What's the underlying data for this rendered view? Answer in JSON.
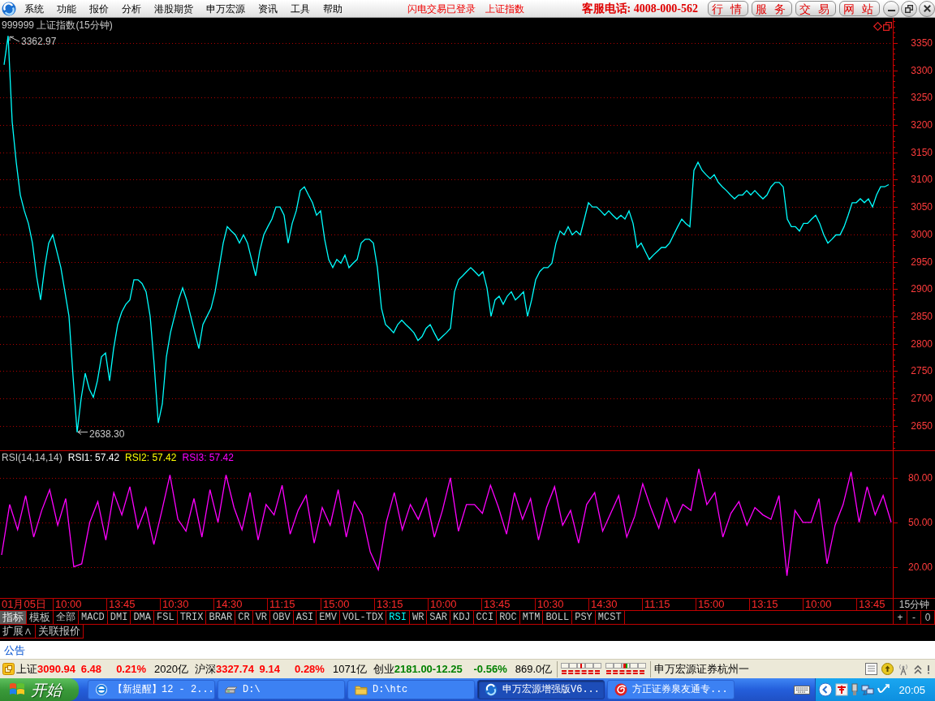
{
  "menu_bar": {
    "items": [
      "系统",
      "功能",
      "报价",
      "分析",
      "港股期货",
      "申万宏源",
      "资讯",
      "工具",
      "帮助"
    ],
    "status_texts": [
      "闪电交易已登录",
      "上证指数"
    ],
    "hotline": "客服电话: 4008-000-562",
    "buttons": [
      "行 情",
      "服 务",
      "交 易",
      "网 站"
    ]
  },
  "price_panel": {
    "chart_data": {
      "type": "line",
      "title": "999999 上证指数(15分钟)",
      "grid": true,
      "ylim": [
        2605,
        3396
      ],
      "yticks": [
        2650,
        2700,
        2750,
        2800,
        2850,
        2900,
        2950,
        3000,
        3050,
        3100,
        3150,
        3200,
        3250,
        3300,
        3350
      ],
      "series": [
        {
          "color": "#00ffff",
          "values": [
            3310,
            3363,
            3206,
            3132,
            3072,
            3043,
            3020,
            2984,
            2924,
            2880,
            2939,
            2984,
            2999,
            2969,
            2939,
            2895,
            2850,
            2740,
            2638,
            2700,
            2746,
            2717,
            2702,
            2732,
            2776,
            2783,
            2732,
            2791,
            2835,
            2858,
            2872,
            2880,
            2917,
            2917,
            2910,
            2895,
            2850,
            2761,
            2655,
            2690,
            2776,
            2820,
            2850,
            2880,
            2902,
            2880,
            2850,
            2820,
            2791,
            2835,
            2850,
            2865,
            2895,
            2939,
            2984,
            3014,
            3006,
            2999,
            2984,
            2999,
            2984,
            2954,
            2924,
            2969,
            2999,
            3014,
            3028,
            3050,
            3050,
            3035,
            2984,
            3020,
            3043,
            3080,
            3087,
            3072,
            3058,
            3035,
            3043,
            2991,
            2954,
            2939,
            2954,
            2947,
            2962,
            2939,
            2947,
            2954,
            2984,
            2991,
            2991,
            2984,
            2939,
            2865,
            2835,
            2828,
            2820,
            2835,
            2843,
            2835,
            2828,
            2820,
            2806,
            2813,
            2828,
            2835,
            2820,
            2806,
            2813,
            2820,
            2828,
            2895,
            2917,
            2924,
            2932,
            2939,
            2932,
            2924,
            2932,
            2902,
            2850,
            2880,
            2887,
            2872,
            2887,
            2895,
            2880,
            2887,
            2895,
            2850,
            2880,
            2917,
            2932,
            2939,
            2939,
            2947,
            2984,
            3006,
            2999,
            3014,
            2999,
            3006,
            2999,
            3028,
            3058,
            3050,
            3050,
            3043,
            3035,
            3043,
            3035,
            3028,
            3035,
            3028,
            3043,
            3020,
            2976,
            2984,
            2969,
            2954,
            2962,
            2969,
            2976,
            2976,
            2984,
            2999,
            3014,
            3028,
            3020,
            3014,
            3117,
            3132,
            3117,
            3109,
            3102,
            3109,
            3095,
            3087,
            3080,
            3072,
            3065,
            3072,
            3072,
            3080,
            3072,
            3080,
            3072,
            3065,
            3072,
            3087,
            3095,
            3095,
            3087,
            3028,
            3014,
            3014,
            3006,
            3020,
            3020,
            3028,
            3035,
            3020,
            2999,
            2984,
            2991,
            2999,
            2999,
            3014,
            3035,
            3058,
            3058,
            3065,
            3058,
            3065,
            3050,
            3072,
            3087,
            3087,
            3091
          ]
        }
      ],
      "annotations": [
        "3362.97",
        "2638.30"
      ]
    }
  },
  "rsi_panel": {
    "title": "RSI(14,14,14)",
    "legend": [
      {
        "label": "RSI1: 57.42",
        "color": "#ffffff"
      },
      {
        "label": "RSI2: 57.42",
        "color": "#ffff00"
      },
      {
        "label": "RSI3: 57.42",
        "color": "#ff00ff"
      }
    ],
    "chart_data": {
      "type": "line",
      "grid": true,
      "ylim": [
        -1,
        98
      ],
      "yticks": [
        {
          "value": 20,
          "label": "20.00"
        },
        {
          "value": 50,
          "label": "50.00"
        },
        {
          "value": 80,
          "label": "80.00"
        }
      ],
      "series": [
        {
          "color": "#ff00ff",
          "values": [
            28,
            62,
            45,
            68,
            40,
            58,
            72,
            48,
            66,
            20,
            22,
            50,
            64,
            38,
            70,
            55,
            74,
            46,
            60,
            35,
            58,
            82,
            52,
            44,
            66,
            40,
            72,
            50,
            82,
            60,
            45,
            70,
            38,
            62,
            55,
            75,
            42,
            58,
            68,
            36,
            60,
            48,
            72,
            40,
            64,
            55,
            30,
            18,
            50,
            70,
            45,
            62,
            52,
            66,
            40,
            58,
            80,
            44,
            62,
            62,
            56,
            75,
            60,
            42,
            70,
            52,
            66,
            38,
            60,
            74,
            48,
            58,
            36,
            62,
            70,
            44,
            56,
            68,
            40,
            54,
            76,
            60,
            46,
            66,
            50,
            62,
            58,
            86,
            62,
            70,
            40,
            56,
            64,
            48,
            60,
            55,
            52,
            68,
            14,
            58,
            50,
            50,
            66,
            22,
            48,
            62,
            84,
            50,
            74,
            55,
            68,
            50
          ]
        }
      ]
    }
  },
  "time_axis": {
    "labels": [
      "01月05日",
      "10:00",
      "13:45",
      "10:30",
      "14:30",
      "11:15",
      "15:00",
      "13:15",
      "10:00",
      "13:45",
      "10:30",
      "14:30",
      "11:15",
      "15:00",
      "13:15",
      "10:00",
      "13:45"
    ],
    "period": "15分钟"
  },
  "indicator_bar": {
    "mode_tabs": [
      {
        "label": "指标",
        "selected": true
      },
      {
        "label": "模板",
        "selected": false
      }
    ],
    "tabs": [
      {
        "label": "全部",
        "selected": false
      },
      {
        "label": "MACD",
        "selected": false
      },
      {
        "label": "DMI",
        "selected": false
      },
      {
        "label": "DMA",
        "selected": false
      },
      {
        "label": "FSL",
        "selected": false
      },
      {
        "label": "TRIX",
        "selected": false
      },
      {
        "label": "BRAR",
        "selected": false
      },
      {
        "label": "CR",
        "selected": false
      },
      {
        "label": "VR",
        "selected": false
      },
      {
        "label": "OBV",
        "selected": false
      },
      {
        "label": "ASI",
        "selected": false
      },
      {
        "label": "EMV",
        "selected": false
      },
      {
        "label": "VOL-TDX",
        "selected": false
      },
      {
        "label": "RSI",
        "selected": true
      },
      {
        "label": "WR",
        "selected": false
      },
      {
        "label": "SAR",
        "selected": false
      },
      {
        "label": "KDJ",
        "selected": false
      },
      {
        "label": "CCI",
        "selected": false
      },
      {
        "label": "ROC",
        "selected": false
      },
      {
        "label": "MTM",
        "selected": false
      },
      {
        "label": "BOLL",
        "selected": false
      },
      {
        "label": "PSY",
        "selected": false
      },
      {
        "label": "MCST",
        "selected": false
      }
    ],
    "zoom_buttons": [
      "+",
      "-",
      "0"
    ]
  },
  "extra_bar": {
    "buttons": [
      "扩展∧",
      "关联报价"
    ]
  },
  "notice": {
    "label": "公告"
  },
  "status_bar": {
    "quotes": [
      {
        "name": "上证",
        "price": "3090.94",
        "change": "6.48",
        "percent": "0.21%",
        "amount": "2020亿",
        "color": "#ff0000"
      },
      {
        "name": "沪深",
        "price": "3327.74",
        "change": "9.14",
        "percent": "0.28%",
        "amount": "1071亿",
        "color": "#ff0000"
      },
      {
        "name": "创业",
        "price": "2181.00",
        "change": "-12.25",
        "percent": "-0.56%",
        "amount": "869.0亿",
        "color": "#008000"
      }
    ],
    "broker": "申万宏源证券杭州一"
  },
  "taskbar": {
    "start": "开始",
    "tasks": [
      {
        "label": "【新提醒】12 - 2...",
        "kind": "ring",
        "selected": false
      },
      {
        "label": "D:\\",
        "kind": "drive",
        "selected": false
      },
      {
        "label": "D:\\htc",
        "kind": "folder",
        "selected": false
      },
      {
        "label": "申万宏源增强版V6...",
        "kind": "swirl",
        "selected": true
      },
      {
        "label": "方正证券泉友通专...",
        "kind": "spiral",
        "selected": false
      }
    ],
    "clock": "20:05"
  }
}
